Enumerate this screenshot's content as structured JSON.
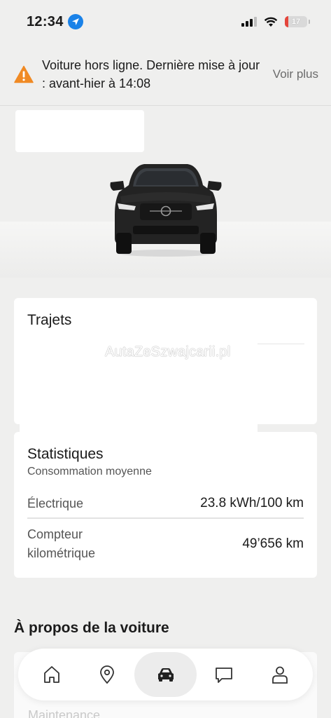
{
  "status_bar": {
    "time": "12:34",
    "battery_level": "17",
    "battery_fraction": 0.17,
    "icons": [
      "location-arrow-icon",
      "signal-icon",
      "wifi-icon",
      "battery-icon"
    ]
  },
  "alert": {
    "message": "Voiture hors ligne. Dernière mise à jour : avant-hier à 14:08",
    "link_label": "Voir plus",
    "icon": "warning-icon",
    "color": "#f08a24"
  },
  "trips": {
    "title": "Trajets",
    "watermark": "AutaZeSzwajcarii.pl"
  },
  "stats": {
    "title": "Statistiques",
    "subtitle": "Consommation moyenne",
    "rows": [
      {
        "label": "Électrique",
        "value": "23.8 kWh/100 km"
      },
      {
        "label": "Compteur kilométrique",
        "value": "49’656 km"
      }
    ]
  },
  "about": {
    "heading": "À propos de la voiture",
    "partial_item": "Maintenance"
  },
  "nav": {
    "items": [
      {
        "name": "home",
        "icon": "home-icon",
        "active": false
      },
      {
        "name": "map",
        "icon": "location-pin-icon",
        "active": false
      },
      {
        "name": "car",
        "icon": "car-icon",
        "active": true
      },
      {
        "name": "messages",
        "icon": "chat-icon",
        "active": false
      },
      {
        "name": "profile",
        "icon": "person-icon",
        "active": false
      }
    ]
  }
}
